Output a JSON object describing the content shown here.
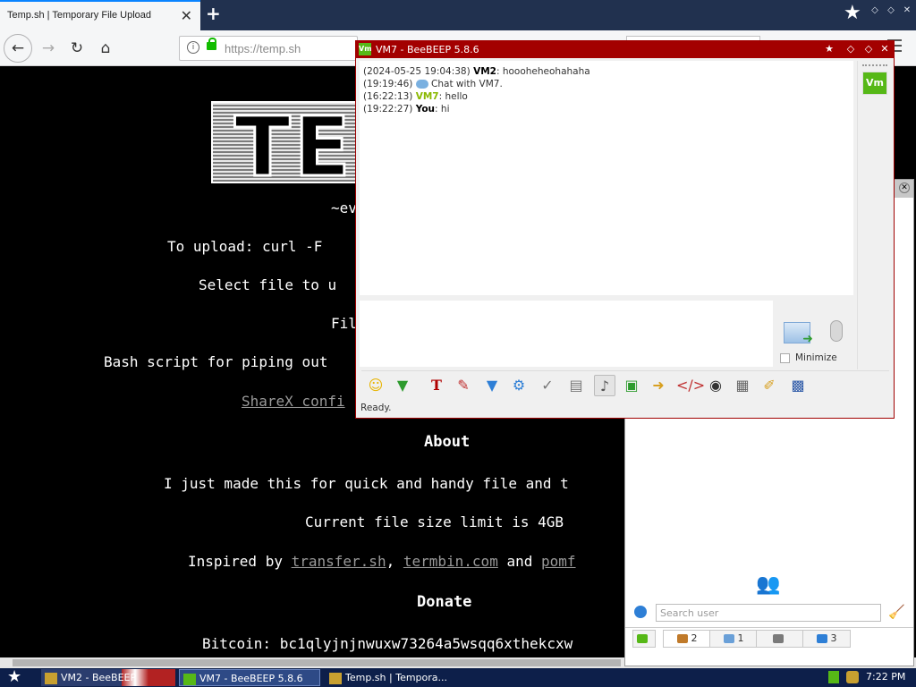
{
  "browser": {
    "tab_title": "Temp.sh | Temporary File Upload",
    "tab_close": "✕",
    "new_tab": "+",
    "url": "https://temp.sh"
  },
  "page": {
    "logo_text": "TE",
    "lines": [
      {
        "text": "~ev"
      },
      {
        "text": "To upload: curl -F"
      },
      {
        "text": "Select file to u"
      },
      {
        "text": "Fil"
      },
      {
        "text": "Bash script for piping out"
      },
      {
        "text": "ShareX confi"
      }
    ],
    "about_heading": "About",
    "about_text": "I just made this for quick and handy file and t",
    "limit_text": "Current file size limit is 4GB",
    "inspired_prefix": "Inspired by",
    "inspired_link1": "transfer.sh",
    "inspired_comma": ",",
    "inspired_link2": "termbin.com",
    "inspired_and": "and",
    "inspired_link3": "pomf",
    "donate_heading": "Donate",
    "bitcoin_text": "Bitcoin: bc1qlyjnjnwuxw73264a5wsqq6xthekcxw"
  },
  "chat": {
    "window_title": "VM7 - BeeBEEP 5.8.6",
    "vm_badge": "Vm",
    "messages": [
      {
        "time": "(2024-05-25 19:04:38)",
        "user": "VM2",
        "text": "hoooheheohahaha"
      },
      {
        "time": "(19:19:46)",
        "user": "",
        "text": "Chat with VM7."
      },
      {
        "time": "(16:22:13)",
        "user": "VM7",
        "text": "hello"
      },
      {
        "time": "(19:22:27)",
        "user": "You",
        "text": "hi"
      }
    ],
    "minimize_label": "Minimize",
    "status": "Ready."
  },
  "roster": {
    "search_placeholder": "Search user",
    "tabs": [
      {
        "count": "2",
        "color": "#c07a2a"
      },
      {
        "count": "1",
        "color": "#6aa0d8"
      },
      {
        "count": "",
        "color": "#7a7a7a"
      },
      {
        "count": "3",
        "color": "#2e7fd6"
      }
    ]
  },
  "taskbar": {
    "task1": "VM2 - BeeBEEP",
    "task2": "VM7 - BeeBEEP 5.8.6",
    "task3": "Temp.sh | Tempora...",
    "clock": "7:22 PM"
  }
}
